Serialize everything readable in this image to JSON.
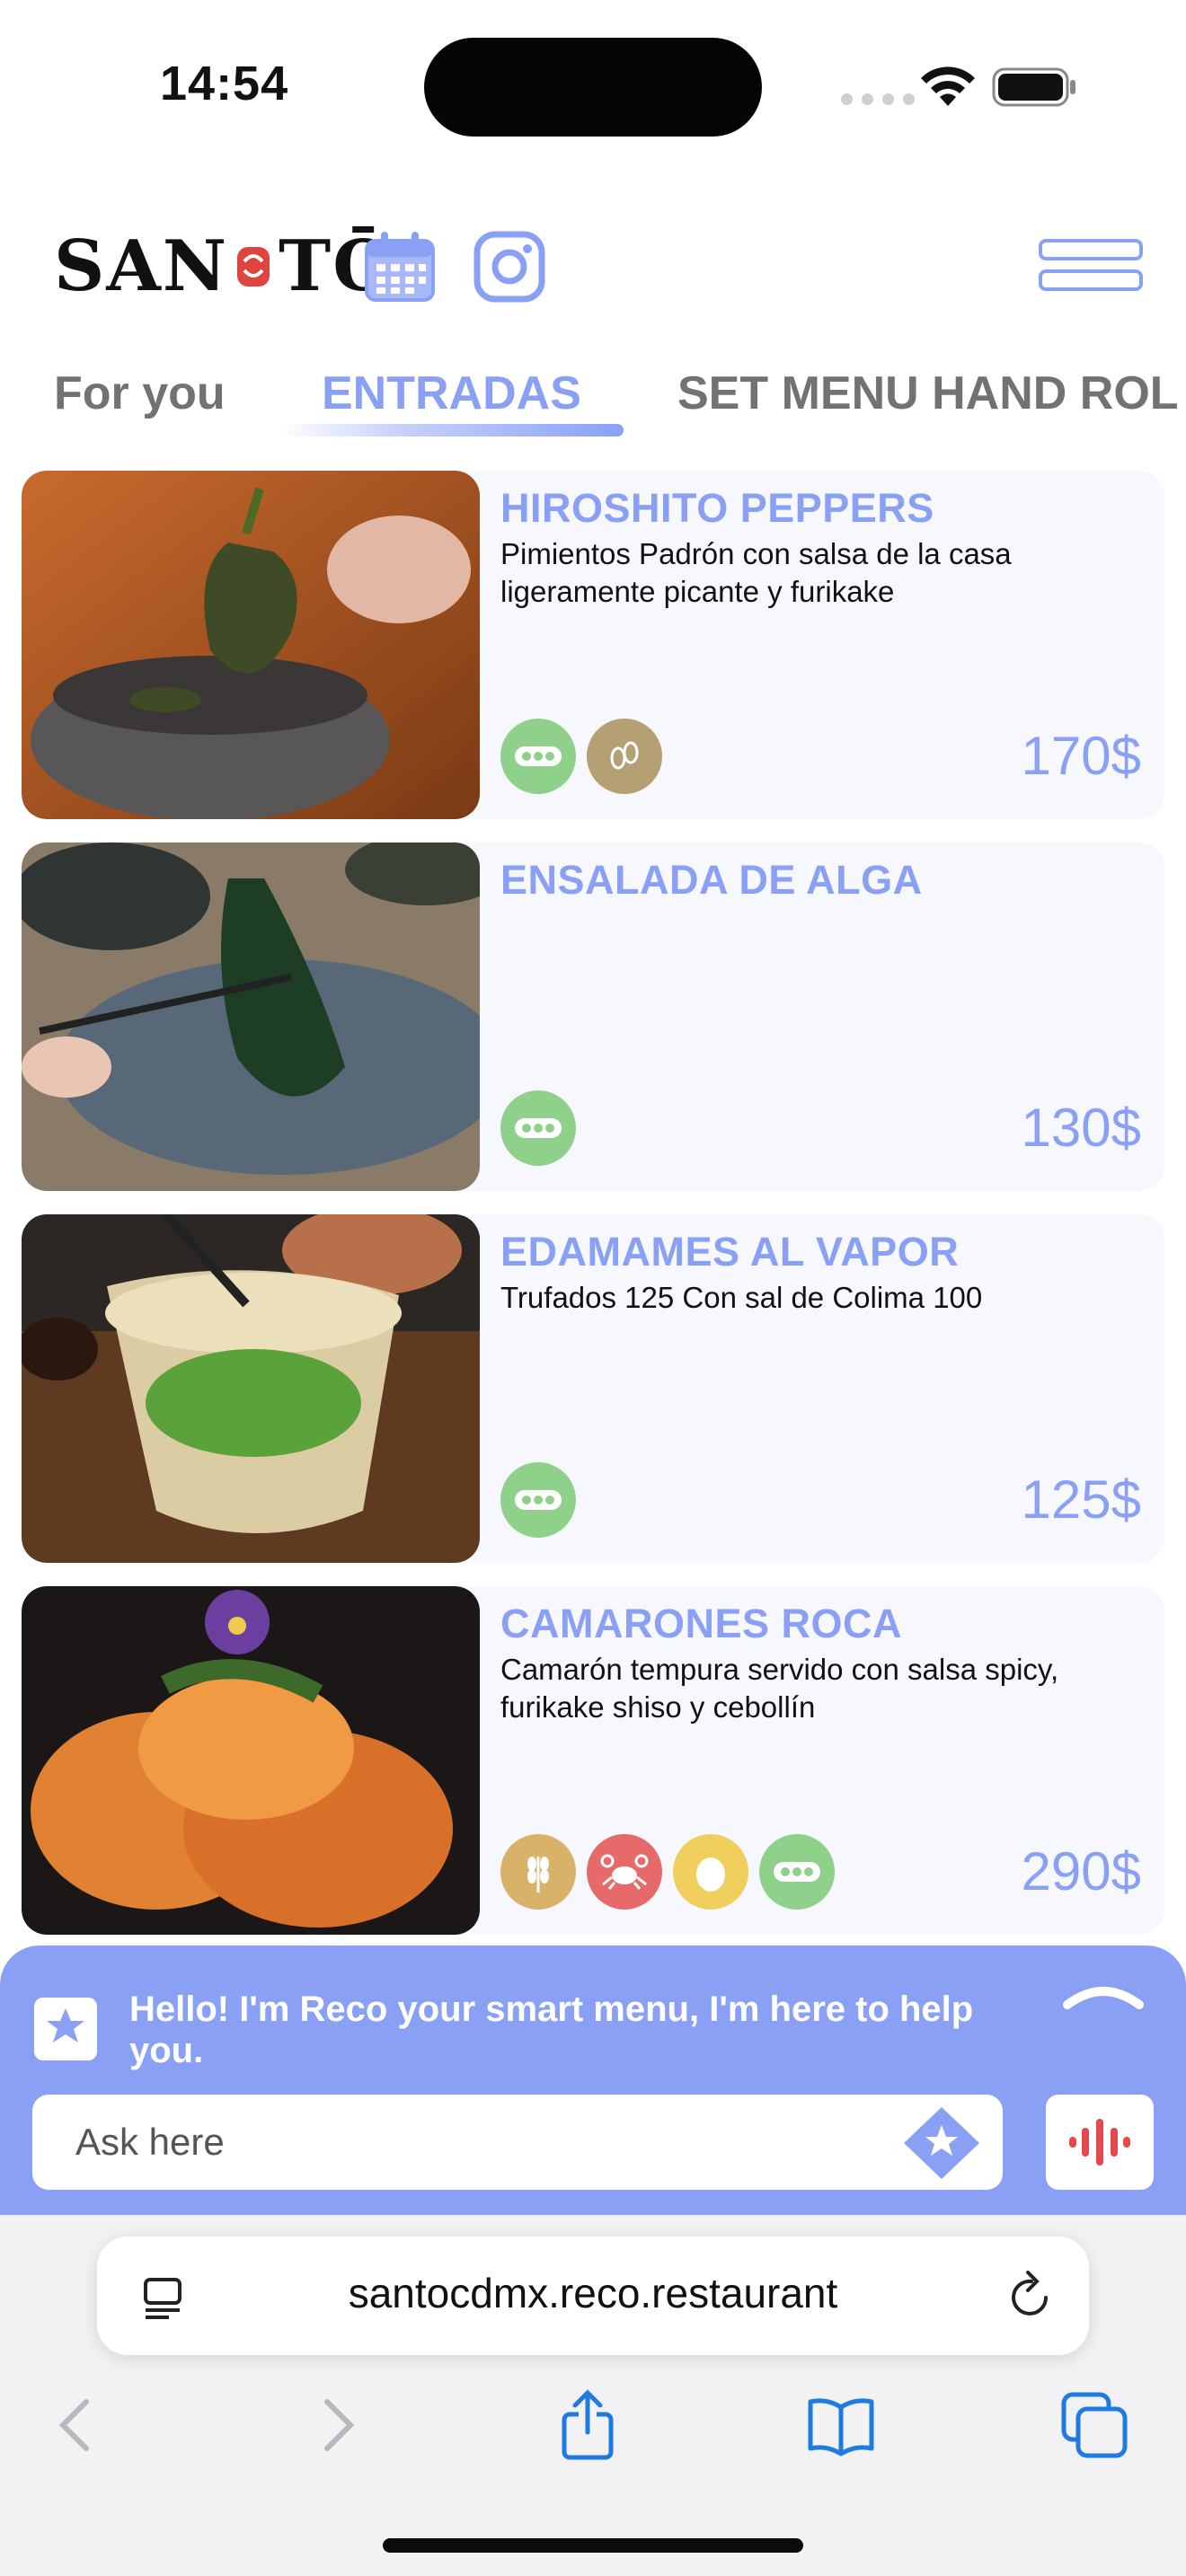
{
  "status_bar": {
    "time": "14:54"
  },
  "header": {
    "logo_text_left": "SAN",
    "logo_text_right": "TŌ",
    "icons": [
      "calendar-icon",
      "instagram-icon",
      "hamburger-menu-icon"
    ]
  },
  "tabs": [
    {
      "label": "For you",
      "active": false
    },
    {
      "label": "ENTRADAS",
      "active": true
    },
    {
      "label": "SET MENU HAND ROL",
      "active": false
    }
  ],
  "dishes": [
    {
      "title": "HIROSHITO PEPPERS",
      "description": "Pimientos Padrón con salsa de la casa ligeramente picante y furikake",
      "price": "170$",
      "allergens": [
        "vegan-pea-icon",
        "seeds-icon"
      ]
    },
    {
      "title": "ENSALADA DE ALGA",
      "description": "",
      "price": "130$",
      "allergens": [
        "vegan-pea-icon"
      ]
    },
    {
      "title": "EDAMAMES AL VAPOR",
      "description": "Trufados 125 Con sal de Colima 100",
      "price": "125$",
      "allergens": [
        "vegan-pea-icon"
      ]
    },
    {
      "title": "CAMARONES ROCA",
      "description": "Camarón tempura servido con salsa spicy, furikake shiso y cebollín",
      "price": "290$",
      "allergens": [
        "gluten-wheat-icon",
        "crustacean-crab-icon",
        "egg-icon",
        "vegan-pea-icon"
      ]
    }
  ],
  "allergen_colors": {
    "vegan-pea-icon": "#8fd18a",
    "seeds-icon": "#b5a074",
    "gluten-wheat-icon": "#d9b26a",
    "crustacean-crab-icon": "#e66a6a",
    "egg-icon": "#f0cf5c"
  },
  "chat": {
    "greeting": "Hello! I'm Reco your smart menu, I'm here to help you.",
    "input_placeholder": "Ask here"
  },
  "browser": {
    "url": "santocdmx.reco.restaurant",
    "nav_icons": [
      "back-icon",
      "forward-icon",
      "share-icon",
      "bookmarks-icon",
      "tabs-icon"
    ]
  },
  "colors": {
    "accent": "#8aa0f5",
    "card_bg": "#f7f8fd",
    "tab_inactive": "#727272"
  }
}
